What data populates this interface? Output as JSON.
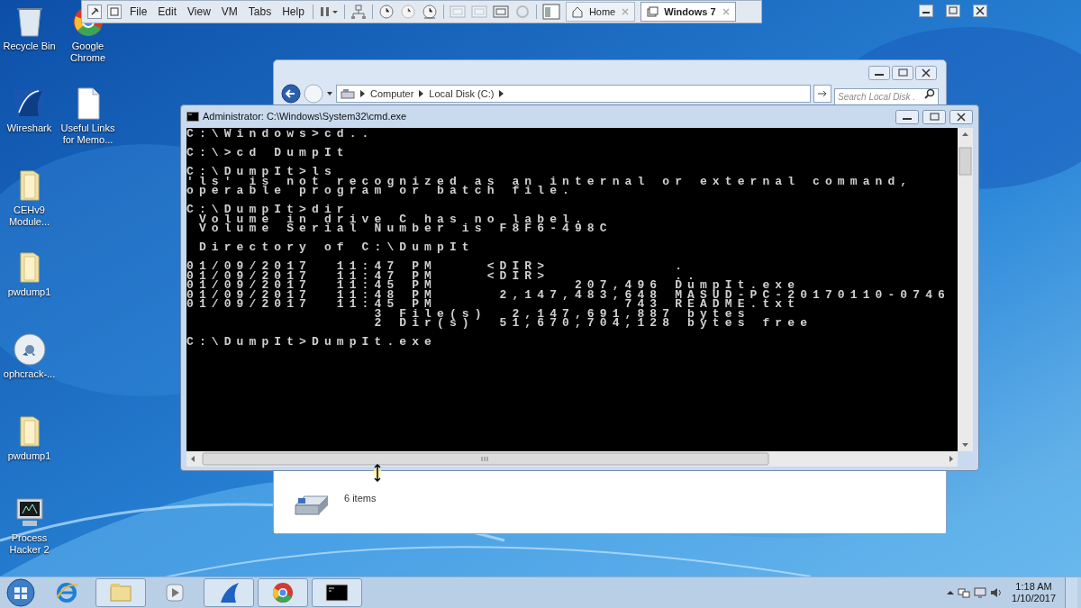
{
  "vm_toolbar": {
    "menus": [
      "File",
      "Edit",
      "View",
      "VM",
      "Tabs",
      "Help"
    ],
    "tabs": [
      {
        "label": "Home",
        "selected": false
      },
      {
        "label": "Windows 7",
        "selected": true
      }
    ]
  },
  "desktop_icons": [
    [
      {
        "label": "Recycle Bin",
        "kind": "recycle"
      },
      {
        "label": "Google Chrome",
        "kind": "chrome"
      }
    ],
    [
      {
        "label": "Wireshark",
        "kind": "wireshark"
      },
      {
        "label": "Useful Links for Memo...",
        "kind": "document"
      }
    ],
    [
      {
        "label": "CEHv9 Module...",
        "kind": "folder"
      }
    ],
    [
      {
        "label": "pwdump1",
        "kind": "folder"
      }
    ],
    [
      {
        "label": "ophcrack-...",
        "kind": "disc"
      }
    ],
    [
      {
        "label": "pwdump1",
        "kind": "folder"
      }
    ],
    [
      {
        "label": "Process Hacker 2",
        "kind": "monitor"
      }
    ]
  ],
  "explorer": {
    "breadcrumb": [
      "Computer",
      "Local Disk (C:)"
    ],
    "search": {
      "placeholder": "Search Local Disk ."
    },
    "status": "6 items"
  },
  "cmd": {
    "title": "Administrator: C:\\Windows\\System32\\cmd.exe",
    "blocks": [
      [
        "C:\\Windows>cd.."
      ],
      [
        "C:\\>cd DumpIt"
      ],
      [
        "C:\\DumpIt>ls",
        "'ls' is not recognized as an internal or external command,",
        "operable program or batch file."
      ],
      [
        "C:\\DumpIt>dir",
        " Volume in drive C has no label.",
        " Volume Serial Number is F8F6-498C"
      ],
      [
        " Directory of C:\\DumpIt"
      ],
      [
        "01/09/2017  11:47 PM    <DIR>          .",
        "01/09/2017  11:47 PM    <DIR>          ..",
        "01/09/2017  11:45 PM           207,496 DumpIt.exe",
        "01/09/2017  11:48 PM     2,147,483,648 MASUD-PC-20170110-0746",
        "01/09/2017  11:45 PM               743 README.txt",
        "               3 File(s)  2,147,691,887 bytes",
        "               2 Dir(s)  51,670,704,128 bytes free"
      ],
      [
        "C:\\DumpIt>DumpIt.exe"
      ]
    ]
  },
  "taskbar": {
    "apps": [
      {
        "kind": "ie",
        "running": false
      },
      {
        "kind": "explorer",
        "running": true
      },
      {
        "kind": "media",
        "running": false
      },
      {
        "kind": "wireshark",
        "running": true
      },
      {
        "kind": "chrome",
        "running": true
      },
      {
        "kind": "cmd",
        "running": true
      }
    ],
    "time": "1:18 AM",
    "date": "1/10/2017"
  }
}
